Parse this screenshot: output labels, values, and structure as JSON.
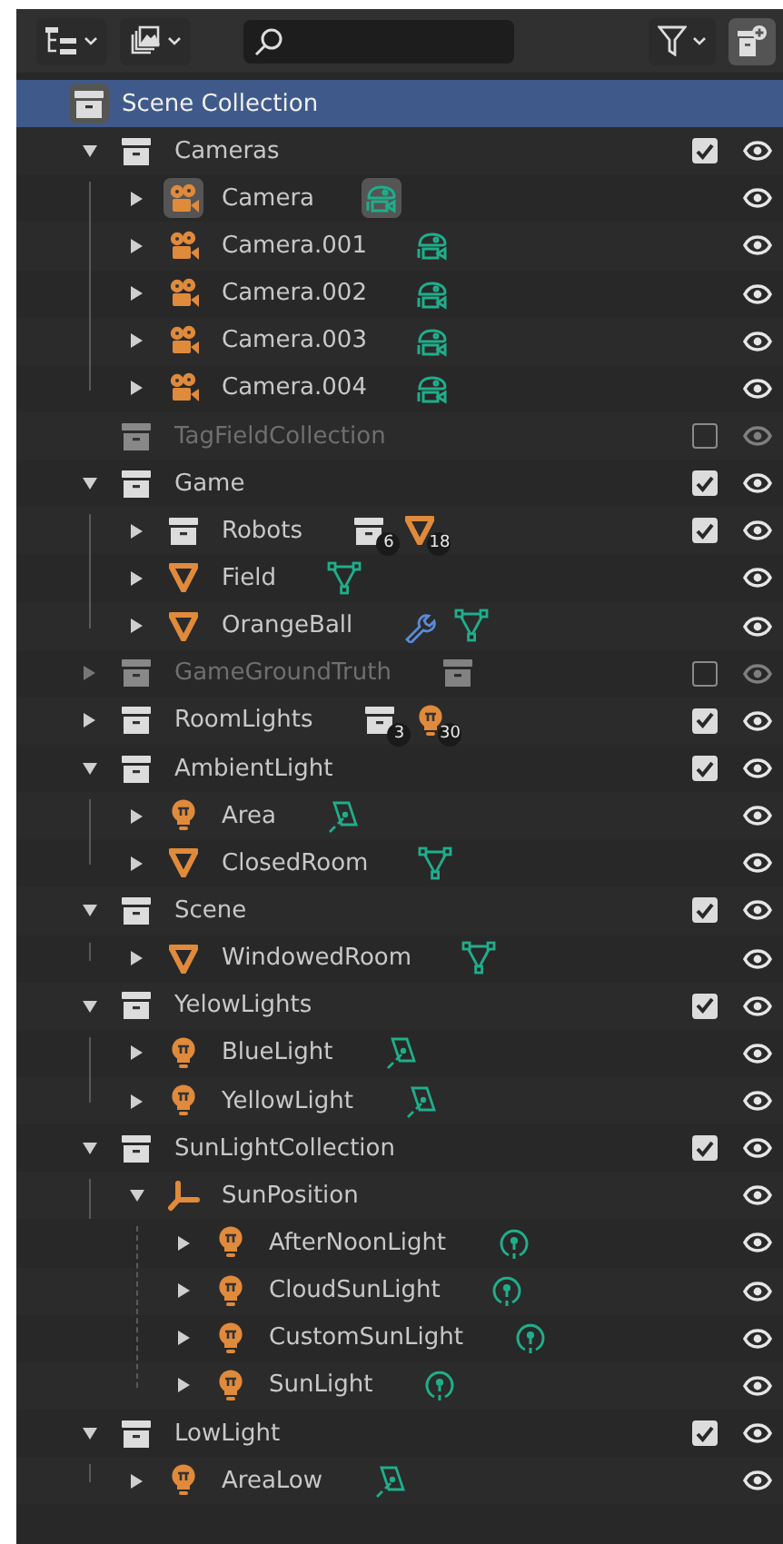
{
  "root": {
    "name": "Scene Collection",
    "selected": true,
    "active": true
  },
  "tree": [
    {
      "name": "Cameras",
      "kind": "collection",
      "expandable": true,
      "expanded": true,
      "selected": false,
      "checked": true,
      "excluded": false,
      "children": [
        {
          "name": "Camera",
          "kind": "camera",
          "expandable": true,
          "expanded": false,
          "selected": false,
          "active": true,
          "extras": [
            {
              "kind": "camera_data",
              "active": true
            }
          ]
        },
        {
          "name": "Camera.001",
          "kind": "camera",
          "expandable": true,
          "expanded": false,
          "selected": false,
          "extras": [
            {
              "kind": "camera_data",
              "active": false
            }
          ]
        },
        {
          "name": "Camera.002",
          "kind": "camera",
          "expandable": true,
          "expanded": false,
          "selected": false,
          "extras": [
            {
              "kind": "camera_data",
              "active": false
            }
          ]
        },
        {
          "name": "Camera.003",
          "kind": "camera",
          "expandable": true,
          "expanded": false,
          "selected": false,
          "extras": [
            {
              "kind": "camera_data",
              "active": false
            }
          ]
        },
        {
          "name": "Camera.004",
          "kind": "camera",
          "expandable": true,
          "expanded": false,
          "selected": false,
          "extras": [
            {
              "kind": "camera_data",
              "active": false
            }
          ]
        }
      ]
    },
    {
      "name": "TagFieldCollection",
      "kind": "collection",
      "expandable": false,
      "selected": false,
      "checked": false,
      "excluded": true
    },
    {
      "name": "Game",
      "kind": "collection",
      "expandable": true,
      "expanded": true,
      "selected": false,
      "checked": true,
      "excluded": false,
      "children": [
        {
          "name": "Robots",
          "kind": "collection",
          "expandable": true,
          "expanded": false,
          "selected": false,
          "checked": true,
          "excluded": false,
          "extras": [
            {
              "kind": "collection",
              "count": "6"
            },
            {
              "kind": "mesh",
              "count": "18"
            }
          ]
        },
        {
          "name": "Field",
          "kind": "mesh",
          "expandable": true,
          "expanded": false,
          "selected": false,
          "extras": [
            {
              "kind": "mesh_data"
            }
          ]
        },
        {
          "name": "OrangeBall",
          "kind": "mesh",
          "expandable": true,
          "expanded": false,
          "selected": false,
          "extras": [
            {
              "kind": "modifier"
            },
            {
              "kind": "mesh_data"
            }
          ]
        }
      ]
    },
    {
      "name": "GameGroundTruth",
      "kind": "collection",
      "expandable": true,
      "expanded": false,
      "selected": false,
      "checked": false,
      "excluded": true,
      "extras": [
        {
          "kind": "collection"
        }
      ]
    },
    {
      "name": "RoomLights",
      "kind": "collection",
      "expandable": true,
      "expanded": false,
      "selected": false,
      "checked": true,
      "excluded": false,
      "extras": [
        {
          "kind": "collection",
          "count": "3"
        },
        {
          "kind": "light",
          "count": "30"
        }
      ]
    },
    {
      "name": "AmbientLight",
      "kind": "collection",
      "expandable": true,
      "expanded": true,
      "selected": false,
      "checked": true,
      "excluded": false,
      "children": [
        {
          "name": "Area",
          "kind": "light",
          "expandable": true,
          "expanded": false,
          "selected": false,
          "extras": [
            {
              "kind": "area_light"
            }
          ]
        },
        {
          "name": "ClosedRoom",
          "kind": "mesh",
          "expandable": true,
          "expanded": false,
          "selected": false,
          "extras": [
            {
              "kind": "mesh_data"
            }
          ]
        }
      ]
    },
    {
      "name": "Scene",
      "kind": "collection",
      "expandable": true,
      "expanded": true,
      "selected": false,
      "checked": true,
      "excluded": false,
      "children": [
        {
          "name": "WindowedRoom",
          "kind": "mesh",
          "expandable": true,
          "expanded": false,
          "selected": false,
          "extras": [
            {
              "kind": "mesh_data"
            }
          ]
        }
      ]
    },
    {
      "name": "YelowLights",
      "kind": "collection",
      "expandable": true,
      "expanded": true,
      "selected": false,
      "checked": true,
      "excluded": false,
      "children": [
        {
          "name": "BlueLight",
          "kind": "light",
          "expandable": true,
          "expanded": false,
          "selected": false,
          "extras": [
            {
              "kind": "area_light"
            }
          ]
        },
        {
          "name": "YellowLight",
          "kind": "light",
          "expandable": true,
          "expanded": false,
          "selected": false,
          "extras": [
            {
              "kind": "area_light"
            }
          ]
        }
      ]
    },
    {
      "name": "SunLightCollection",
      "kind": "collection",
      "expandable": true,
      "expanded": true,
      "selected": false,
      "checked": true,
      "excluded": false,
      "children": [
        {
          "name": "SunPosition",
          "kind": "empty",
          "expandable": true,
          "expanded": true,
          "selected": false,
          "children": [
            {
              "name": "AfterNoonLight",
              "kind": "light",
              "expandable": true,
              "expanded": false,
              "selected": false,
              "extras": [
                {
                  "kind": "sun_light"
                }
              ]
            },
            {
              "name": "CloudSunLight",
              "kind": "light",
              "expandable": true,
              "expanded": false,
              "selected": false,
              "extras": [
                {
                  "kind": "sun_light"
                }
              ]
            },
            {
              "name": "CustomSunLight",
              "kind": "light",
              "expandable": true,
              "expanded": false,
              "selected": false,
              "extras": [
                {
                  "kind": "sun_light"
                }
              ]
            },
            {
              "name": "SunLight",
              "kind": "light",
              "expandable": true,
              "expanded": false,
              "selected": false,
              "extras": [
                {
                  "kind": "sun_light"
                }
              ]
            }
          ]
        }
      ]
    },
    {
      "name": "LowLight",
      "kind": "collection",
      "expandable": true,
      "expanded": true,
      "selected": false,
      "checked": true,
      "excluded": false,
      "children": [
        {
          "name": "AreaLow",
          "kind": "light",
          "expandable": true,
          "expanded": false,
          "selected": false,
          "extras": [
            {
              "kind": "area_light"
            }
          ]
        }
      ]
    }
  ]
}
